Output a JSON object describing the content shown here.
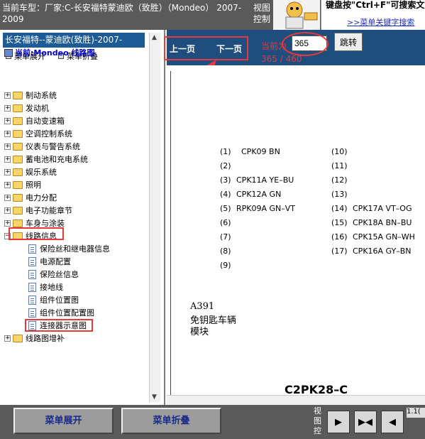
{
  "header": {
    "title": "当前车型：厂家:C-长安福特蒙迪欧（致胜）（Mondeo） 2007-2009",
    "view_ctrl": "视图控制",
    "tip": "键盘按\"Ctrl+F\"可搜索文字!",
    "tip_link": ">>菜单关键字搜索"
  },
  "left_panel": {
    "title": "长安福特--蒙迪欧(致胜)-2007-",
    "expand_all": "菜单展开",
    "collapse_all": "菜单折叠",
    "root": "当前:Mondeo 线路图",
    "categories": [
      "制动系统",
      "发动机",
      "自动变速箱",
      "空调控制系统",
      "仪表与警告系统",
      "蓄电池和充电系统",
      "娱乐系统",
      "照明",
      "电力分配",
      "电子功能章节",
      "车身与涂装",
      "线路信息"
    ],
    "leaves": [
      "保险丝和继电器信息",
      "电源配置",
      "保险丝信息",
      "接地线",
      "组件位置图",
      "组件位置配置图",
      "连接器示意图"
    ],
    "last_category": "线路图增补"
  },
  "nav": {
    "prev": "上一页",
    "next": "下一页",
    "current_label": "当前为",
    "current_page": "365",
    "page_count": "365 / 460",
    "jump": "跳转"
  },
  "document": {
    "pins_left": [
      {
        "n": "(1)",
        "v": "CPK09 BN"
      },
      {
        "n": "(2)",
        "v": ""
      },
      {
        "n": "(3)",
        "v": "CPK11A YE–BU"
      },
      {
        "n": "(4)",
        "v": "CPK12A GN"
      },
      {
        "n": "(5)",
        "v": "RPK09A GN–VT"
      },
      {
        "n": "(6)",
        "v": ""
      },
      {
        "n": "(7)",
        "v": ""
      },
      {
        "n": "(8)",
        "v": ""
      },
      {
        "n": "(9)",
        "v": ""
      }
    ],
    "pins_right": [
      {
        "n": "(10)",
        "v": ""
      },
      {
        "n": "(11)",
        "v": ""
      },
      {
        "n": "(12)",
        "v": ""
      },
      {
        "n": "(13)",
        "v": ""
      },
      {
        "n": "(14)",
        "v": "CPK17A VT–OG"
      },
      {
        "n": "(15)",
        "v": "CPK18A BN–BU"
      },
      {
        "n": "(16)",
        "v": "CPK15A GN–WH"
      },
      {
        "n": "(17)",
        "v": "CPK16A GY–BN"
      }
    ],
    "component_code": "A391",
    "component_name_1": "免钥匙车辆",
    "component_name_2": "模块",
    "connector": "C2PK28–C"
  },
  "bottom": {
    "expand_btn": "菜单展开",
    "collapse_btn": "菜单折叠",
    "view_ctrl": "视图控",
    "version": "1.1("
  },
  "colors": {
    "accent_red": "#e53a3a",
    "nav_blue": "#1f4e7e",
    "title_blue": "#1c5b95"
  }
}
